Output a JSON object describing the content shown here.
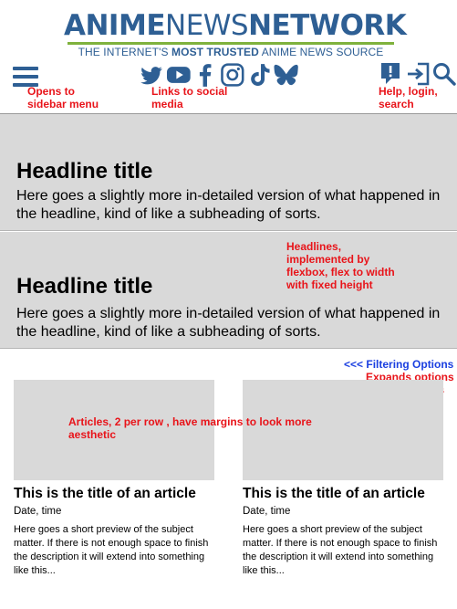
{
  "brand": {
    "name_bold": "ANIME",
    "name_regular": "NEWS",
    "name_bold2": "NETWORK",
    "tagline_pre": "THE INTERNET'S ",
    "tagline_bold": "MOST TRUSTED",
    "tagline_post": " ANIME NEWS SOURCE",
    "colors": {
      "primary": "#2e5f94",
      "accent": "#7fb23d"
    }
  },
  "nav": {
    "menu_icon": "hamburger-menu-icon",
    "social_icons": [
      "twitter-icon",
      "youtube-icon",
      "facebook-icon",
      "instagram-icon",
      "tiktok-icon",
      "bluesky-icon"
    ],
    "utility_icons": [
      "help-icon",
      "login-icon",
      "search-icon"
    ]
  },
  "annotations": {
    "menu": "Opens to\nsidebar menu",
    "social": "Links to social\nmedia",
    "utility": "Help, login,\nsearch",
    "headlines": "Headlines,\nimplemented by\nflexbox, flex to width\nwith fixed height",
    "filter_link": "<<< Filtering Options",
    "filter_note": "Expands options\nto filter articles",
    "articles": "Articles, 2 per row , have margins to look more\naesthetic",
    "annotation_color": "#e8141a",
    "link_color": "#1a3fe0"
  },
  "headlines": [
    {
      "title": "Headline title",
      "subtitle": "Here goes a slightly more in-detailed version of  what happened in the headline, kind of like a subheading of sorts."
    },
    {
      "title": "Headline title",
      "subtitle": "Here goes a slightly more in-detailed version of  what happened in the headline, kind of like a subheading of sorts."
    }
  ],
  "articles": [
    {
      "title": "This is the title of an article",
      "date": "Date, time",
      "preview": "Here goes a short preview of the subject matter. If there is not enough space to finish the description it will extend into something like this..."
    },
    {
      "title": "This is the title of an article",
      "date": "Date, time",
      "preview": "Here goes a short preview of the subject matter. If there is not enough space to finish the description it will extend into something like this..."
    }
  ]
}
